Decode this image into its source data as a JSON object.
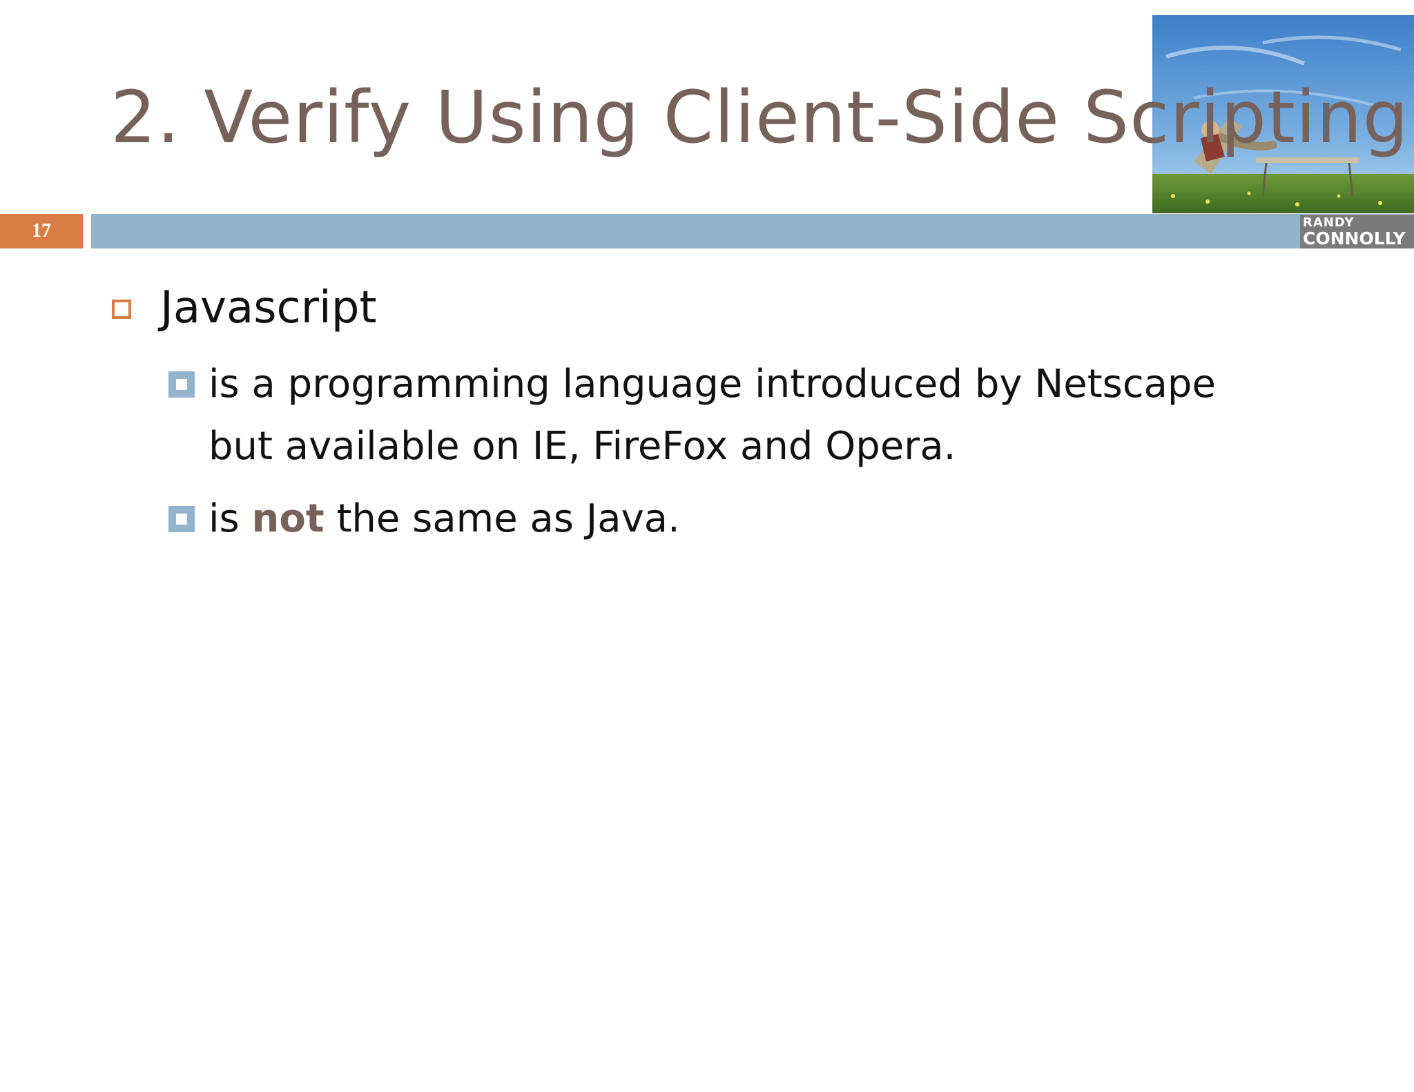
{
  "slide": {
    "title": "2. Verify Using Client-Side Scripting",
    "page_number": "17",
    "logo": {
      "line1": "RANDY",
      "line2": "CONNOLLY"
    },
    "bullets": [
      {
        "text": "Javascript",
        "sub": [
          {
            "text": "is a programming language introduced by Netscape but available on IE, FireFox and Opera."
          },
          {
            "before": "is ",
            "emphasis": "not",
            "after": " the same as Java."
          }
        ]
      }
    ]
  },
  "colors": {
    "title": "#76625a",
    "accent_orange": "#d97d46",
    "accent_blue": "#93b3cd"
  },
  "icons": [
    "hollow-square-bullet-icon",
    "blue-square-bullet-icon"
  ]
}
